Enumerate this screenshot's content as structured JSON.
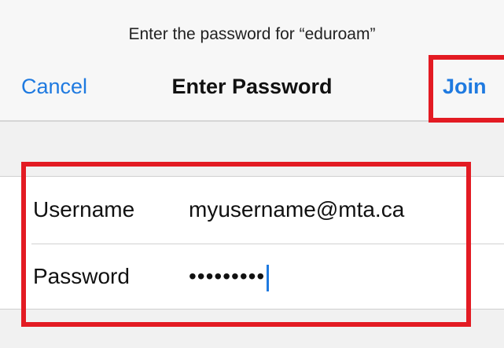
{
  "nav": {
    "prompt": "Enter the password for “eduroam”",
    "title": "Enter Password",
    "cancel_label": "Cancel",
    "join_label": "Join"
  },
  "form": {
    "username": {
      "label": "Username",
      "value": "myusername@mta.ca"
    },
    "password": {
      "label": "Password",
      "masked_value": "•••••••••"
    }
  },
  "colors": {
    "accent": "#1f7ae0",
    "highlight": "#e31b23",
    "background": "#f1f1f1",
    "field_background": "#ffffff"
  },
  "icons": {
    "text_cursor": "caret"
  }
}
